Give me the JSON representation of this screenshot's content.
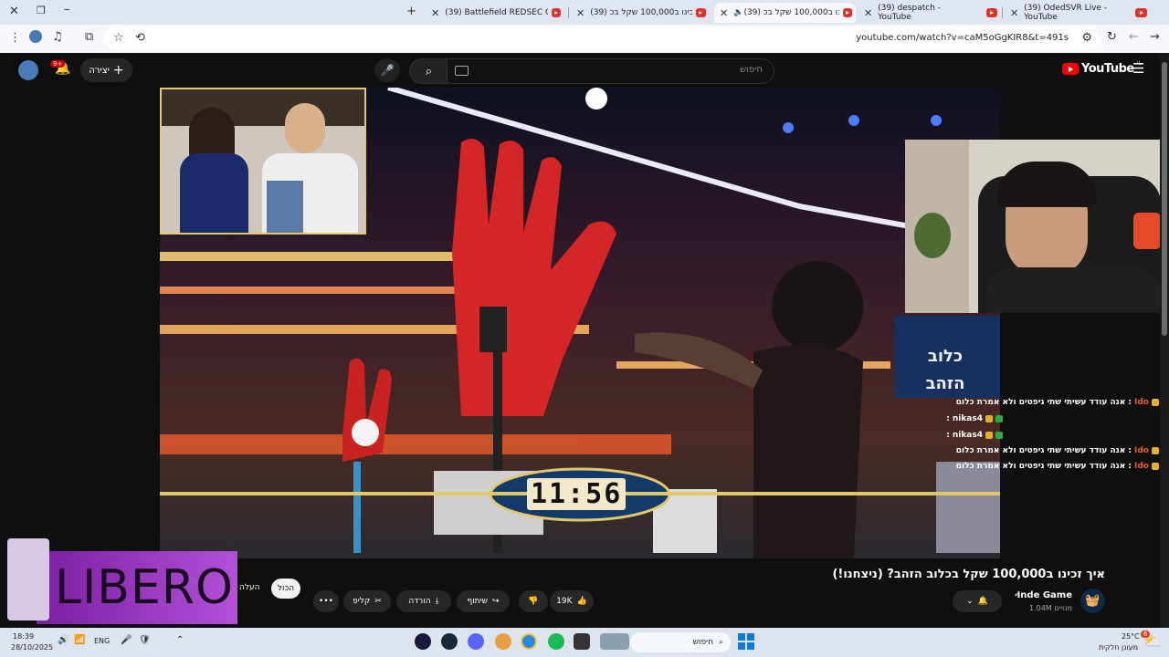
{
  "browser": {
    "tabs": [
      {
        "title": "(39) OdedSVR Live - YouTube"
      },
      {
        "title": "(39) despatch - YouTube"
      },
      {
        "title": "(39) איך זכינו ב100,000 שקל בכ..."
      },
      {
        "title": "(39) איך זכינו ב100,000 שקל בכ..."
      },
      {
        "title": "(39) Battlefield REDSEC Official..."
      }
    ],
    "url": "youtube.com/watch?v=caM5oGgKIR8&t=491s"
  },
  "youtube": {
    "logo": "YouTube",
    "logo_region": "IL",
    "search_placeholder": "חיפוש",
    "create_label": "יצירה",
    "notification_count": "9+"
  },
  "video": {
    "overlay_timer": "11:56",
    "chat": [
      {
        "user": "Ido",
        "text": "אנה עודד עשיתי שתי גיפטים ולא אמרת כלום :"
      },
      {
        "user": "nikas4",
        "text": ":"
      },
      {
        "user": "nikas4",
        "text": ":"
      },
      {
        "user": "Ido",
        "text": "אנה עודד עשיתי שתי גיפטים ולא אמרת כלום :"
      },
      {
        "user": "Ido",
        "text": "אנה עודד עשיתי שתי גיפטים ולא אמרת כלום :"
      }
    ],
    "ad_brand": "LIBERO"
  },
  "watch": {
    "title": "איך זכינו ב100,000 שקל בכלוב הזהב? (ניצחנו!)",
    "channel": "Inde Game",
    "subscribers": "1.04M מנויים",
    "likes": "19K",
    "share_label": "שיתוף",
    "download_label": "הורדה",
    "clip_label": "קליפ",
    "filter_all": "הכול",
    "filter_uploads": "העלה"
  },
  "taskbar": {
    "weather_temp": "25°C",
    "weather_desc": "מעונן חלקית",
    "search_label": "חיפוש",
    "time": "18:39",
    "date": "28/10/2025",
    "lang": "ENG",
    "weather_badge": "6"
  },
  "colors": {
    "yt_red": "#ff0000",
    "bg": "#0f0f0f"
  }
}
